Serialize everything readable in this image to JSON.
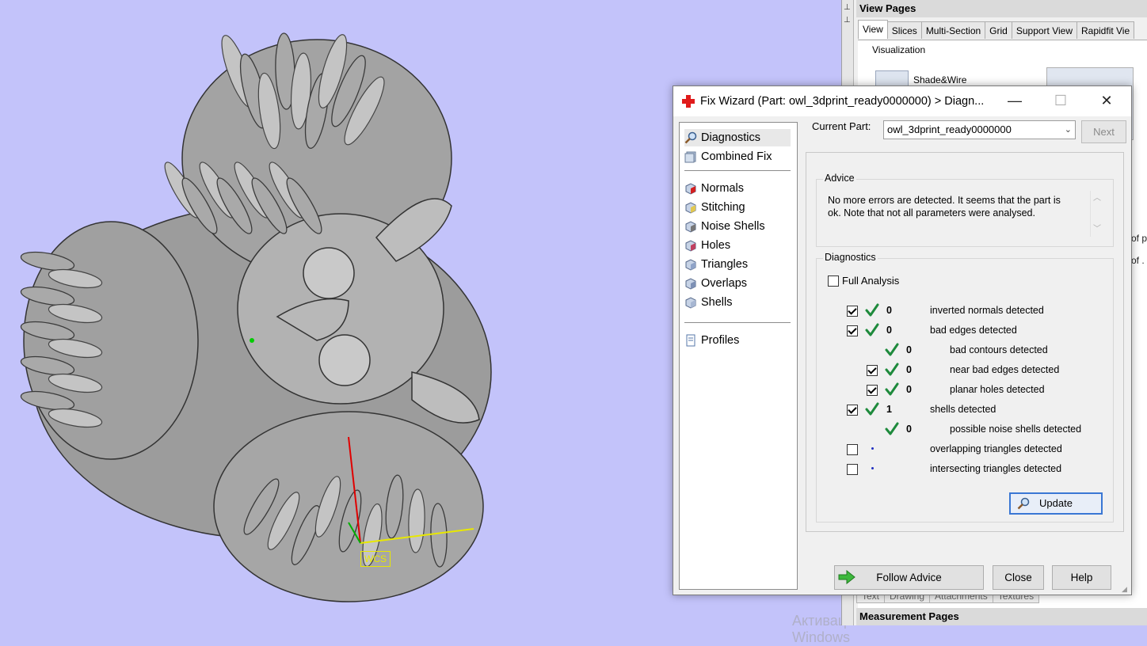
{
  "viewport": {
    "wcs_label": "WCS",
    "watermark": "Активация Windows",
    "model_name": "owl"
  },
  "side_panel": {
    "view_pages_title": "View Pages",
    "tabs": [
      "View",
      "Slices",
      "Multi-Section",
      "Grid",
      "Support View",
      "Rapidfit Vie"
    ],
    "active_tab": "View",
    "visualization_label": "Visualization",
    "shade_mode": "Shade&Wire",
    "bottom_tabs": [
      "Text",
      "Drawing",
      "Attachments",
      "Textures"
    ],
    "measurement_title": "Measurement Pages",
    "fragments": [
      "of p",
      "of ."
    ]
  },
  "dialog": {
    "title": "Fix Wizard (Part: owl_3dprint_ready0000000) > Diagn...",
    "window_buttons": {
      "minimize": "—",
      "maximize": "☐",
      "close": "✕"
    },
    "nav": {
      "top": [
        {
          "label": "Diagnostics",
          "icon": "magnifier-icon",
          "selected": true
        },
        {
          "label": "Combined Fix",
          "icon": "combined-fix-icon",
          "selected": false
        }
      ],
      "tools": [
        {
          "label": "Normals",
          "icon": "normals-icon"
        },
        {
          "label": "Stitching",
          "icon": "stitching-icon"
        },
        {
          "label": "Noise Shells",
          "icon": "noise-shells-icon"
        },
        {
          "label": "Holes",
          "icon": "holes-icon"
        },
        {
          "label": "Triangles",
          "icon": "triangles-icon"
        },
        {
          "label": "Overlaps",
          "icon": "overlaps-icon"
        },
        {
          "label": "Shells",
          "icon": "shells-icon"
        }
      ],
      "profiles": {
        "label": "Profiles",
        "icon": "profiles-icon"
      }
    },
    "current_part_label": "Current Part:",
    "current_part_value": "owl_3dprint_ready0000000",
    "next_label": "Next",
    "advice": {
      "title": "Advice",
      "text": "No more errors are detected. It seems that the part is ok. Note that not all parameters were analysed."
    },
    "diagnostics": {
      "title": "Diagnostics",
      "full_analysis_label": "Full Analysis",
      "full_analysis_checked": false,
      "rows": [
        {
          "checkbox": true,
          "checked": true,
          "status": "ok",
          "count": "0",
          "label": "inverted normals detected",
          "level": 0
        },
        {
          "checkbox": true,
          "checked": true,
          "status": "ok",
          "count": "0",
          "label": "bad edges detected",
          "level": 0
        },
        {
          "checkbox": false,
          "checked": false,
          "status": "ok",
          "count": "0",
          "label": "bad contours detected",
          "level": 1
        },
        {
          "checkbox": true,
          "checked": true,
          "status": "ok",
          "count": "0",
          "label": "near bad edges detected",
          "level": 1
        },
        {
          "checkbox": true,
          "checked": true,
          "status": "ok",
          "count": "0",
          "label": "planar holes detected",
          "level": 1
        },
        {
          "checkbox": true,
          "checked": true,
          "status": "ok",
          "count": "1",
          "label": "shells detected",
          "level": 0
        },
        {
          "checkbox": false,
          "checked": false,
          "status": "ok",
          "count": "0",
          "label": "possible noise shells detected",
          "level": 1
        },
        {
          "checkbox": true,
          "checked": false,
          "status": "pending",
          "count": "",
          "label": "overlapping triangles detected",
          "level": 0
        },
        {
          "checkbox": true,
          "checked": false,
          "status": "pending",
          "count": "",
          "label": "intersecting triangles detected",
          "level": 0
        }
      ],
      "update_label": "Update"
    },
    "buttons": {
      "follow_advice": "Follow Advice",
      "close": "Close",
      "help": "Help"
    },
    "colors": {
      "tick": "#1e8a3c",
      "accent": "#3a77d4",
      "pending_dot": "#2030c0",
      "viewport_bg": "#c3c3fa"
    }
  }
}
